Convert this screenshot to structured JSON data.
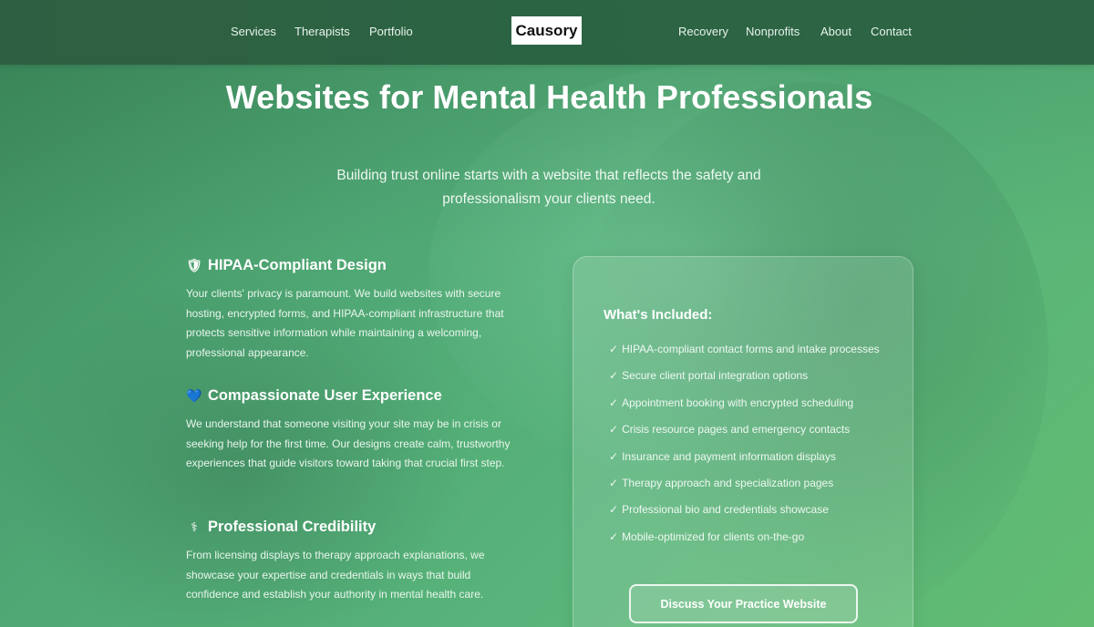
{
  "nav": {
    "left_links": [
      "Services",
      "Therapists",
      "Portfolio"
    ],
    "right_links": [
      "Recovery",
      "Nonprofits",
      "About",
      "Contact"
    ],
    "logo_text": "Causory"
  },
  "hero": {
    "title": "Websites for Mental Health Professionals",
    "subtitle_line1": "Building trust online starts with a website that reflects the safety and",
    "subtitle_line2": "professionalism your clients need."
  },
  "features": [
    {
      "icon": "shield-icon",
      "glyph": "🛡",
      "title": "HIPAA-Compliant Design",
      "text": "Your clients' privacy is paramount. We build websites with secure hosting, encrypted forms, and HIPAA-compliant infrastructure that protects sensitive information while maintaining a welcoming, professional appearance."
    },
    {
      "icon": "blue-heart-icon",
      "glyph": "💙",
      "title": "Compassionate User Experience",
      "text": "We understand that someone visiting your site may be in crisis or seeking help for the first time. Our designs create calm, trustworthy experiences that guide visitors toward taking that crucial first step."
    },
    {
      "icon": "caduceus-icon",
      "glyph": "⚕",
      "title": "Professional Credibility",
      "text": "From licensing displays to therapy approach explanations, we showcase your expertise and credentials in ways that build confidence and establish your authority in mental health care."
    }
  ],
  "included": {
    "title": "What's Included:",
    "check": "✓",
    "items": [
      "HIPAA-compliant contact forms and intake processes",
      "Secure client portal integration options",
      "Appointment booking with encrypted scheduling",
      "Crisis resource pages and emergency contacts",
      "Insurance and payment information displays",
      "Therapy approach and specialization pages",
      "Professional bio and credentials showcase",
      "Mobile-optimized for clients on-the-go"
    ],
    "cta_label": "Discuss Your Practice Website"
  }
}
